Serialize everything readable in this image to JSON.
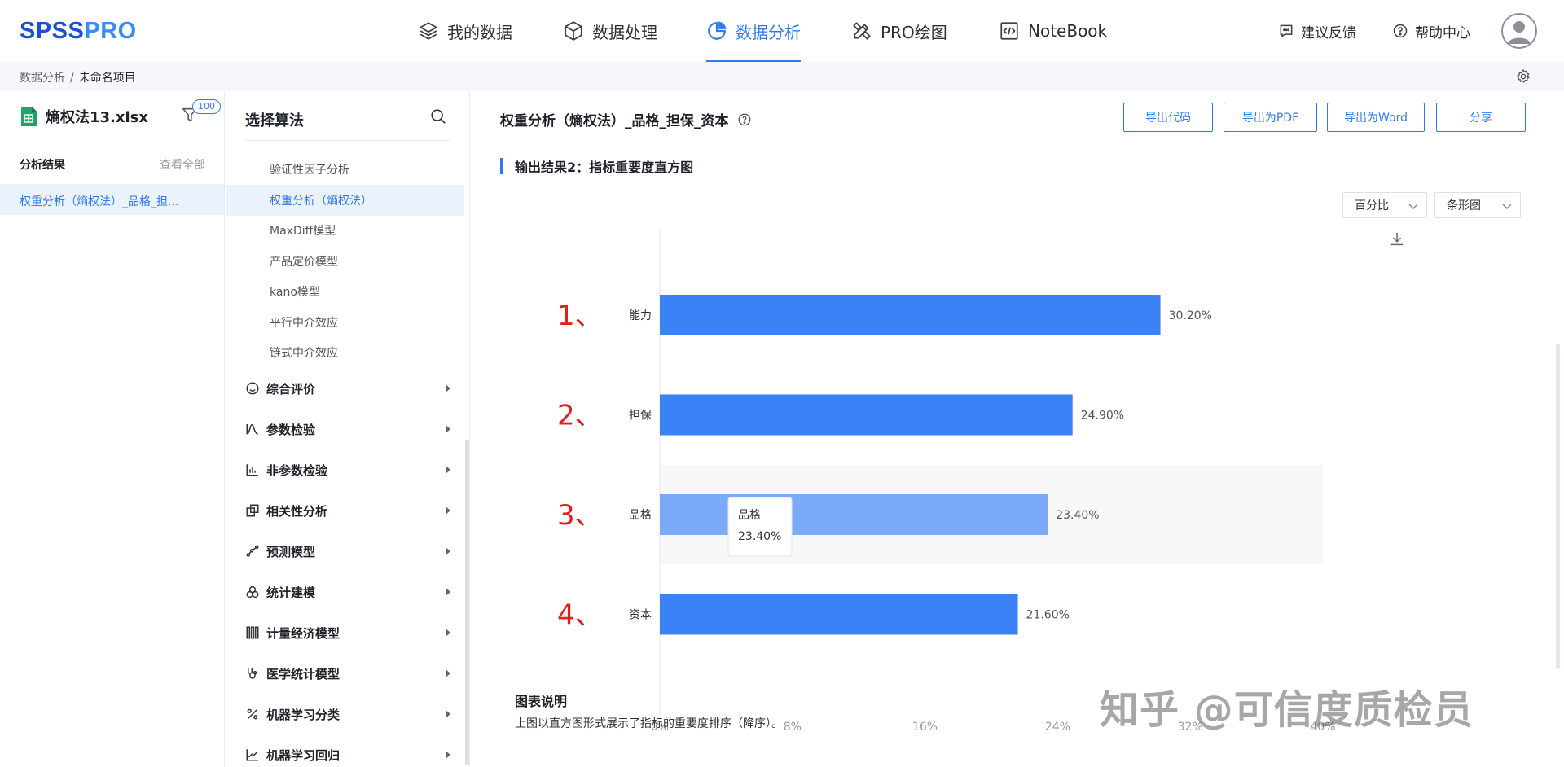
{
  "app": {
    "logo_primary": "SPSS",
    "logo_secondary": "PRO"
  },
  "nav": [
    {
      "label": "我的数据",
      "icon": "layers-icon"
    },
    {
      "label": "数据处理",
      "icon": "cube-icon"
    },
    {
      "label": "数据分析",
      "icon": "pie-chart-icon",
      "active": true
    },
    {
      "label": "PRO绘图",
      "icon": "pencil-ruler-icon"
    },
    {
      "label": "NoteBook",
      "icon": "code-file-icon"
    }
  ],
  "top_right": {
    "feedback": "建议反馈",
    "help": "帮助中心"
  },
  "breadcrumb": {
    "root": "数据分析",
    "separator": "/",
    "current": "未命名项目"
  },
  "left_panel": {
    "file_name": "熵权法13.xlsx",
    "filter_badge": "100",
    "results_title": "分析结果",
    "view_all": "查看全部",
    "selected_result": "权重分析（熵权法）_品格_担..."
  },
  "algorithms": {
    "title": "选择算法",
    "sub_items": [
      "验证性因子分析",
      "权重分析（熵权法）",
      "MaxDiff模型",
      "产品定价模型",
      "kano模型",
      "平行中介效应",
      "链式中介效应"
    ],
    "active_index": 1,
    "categories": [
      {
        "label": "综合评价",
        "icon": "smile-circle-icon"
      },
      {
        "label": "参数检验",
        "icon": "distribution-curve-icon"
      },
      {
        "label": "非参数检验",
        "icon": "bar-chart-icon"
      },
      {
        "label": "相关性分析",
        "icon": "overlap-squares-icon"
      },
      {
        "label": "预测模型",
        "icon": "trend-nodes-icon"
      },
      {
        "label": "统计建模",
        "icon": "three-circles-icon"
      },
      {
        "label": "计量经济模型",
        "icon": "tubes-icon"
      },
      {
        "label": "医学统计模型",
        "icon": "stethoscope-icon"
      },
      {
        "label": "机器学习分类",
        "icon": "percent-icon"
      },
      {
        "label": "机器学习回归",
        "icon": "line-chart-icon"
      }
    ]
  },
  "main": {
    "title": "权重分析（熵权法）_品格_担保_资本",
    "buttons": {
      "export_code": "导出代码",
      "export_pdf": "导出为PDF",
      "export_word": "导出为Word",
      "share": "分享"
    },
    "section_title": "输出结果2：指标重要度直方图",
    "select_unit": "百分比",
    "select_chart": "条形图",
    "notes_title": "图表说明",
    "notes_text": "上图以直方图形式展示了指标的重要度排序（降序）。"
  },
  "chart_data": {
    "type": "bar",
    "orientation": "horizontal",
    "categories": [
      "能力",
      "担保",
      "品格",
      "资本"
    ],
    "values": [
      30.2,
      24.9,
      23.4,
      21.6
    ],
    "value_labels": [
      "30.20%",
      "24.90%",
      "23.40%",
      "21.60%"
    ],
    "xlim": [
      0,
      40
    ],
    "x_ticks": [
      "0%",
      "8%",
      "16%",
      "24%",
      "32%",
      "40%"
    ],
    "bar_color": "#3b82f6",
    "highlight_color": "#7aaaf8",
    "highlight_index": 2,
    "annotations": [
      "1、",
      "2、",
      "3、",
      "4、"
    ],
    "annotation_color": "#e02020",
    "tooltip": {
      "name": "品格",
      "value": "23.40%"
    }
  },
  "watermark": "知乎 @可信度质检员",
  "colors": {
    "accent": "#2e7bf0",
    "logo": "#1a4fd6"
  }
}
